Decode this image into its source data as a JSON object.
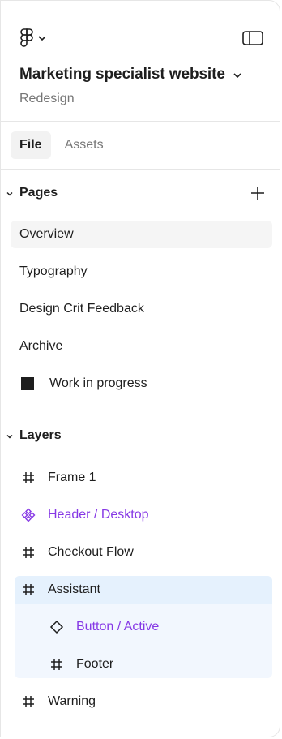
{
  "header": {
    "logo_icon": "figma-logo-icon",
    "menu_caret_icon": "chevron-down-icon",
    "sidebar_toggle_icon": "sidebar-panel-icon",
    "file_title": "Marketing specialist website",
    "file_subtitle": "Redesign"
  },
  "tabs": [
    {
      "label": "File",
      "active": true
    },
    {
      "label": "Assets",
      "active": false
    }
  ],
  "pages": {
    "title": "Pages",
    "add_icon": "plus-icon",
    "items": [
      {
        "label": "Overview",
        "selected": true
      },
      {
        "label": "Typography"
      },
      {
        "label": "Design Crit Feedback"
      },
      {
        "label": "Archive"
      },
      {
        "label": "Work in progress",
        "icon": "black-square-icon"
      }
    ]
  },
  "layers": {
    "title": "Layers",
    "items": [
      {
        "label": "Frame 1",
        "icon": "frame-icon"
      },
      {
        "label": "Header / Desktop",
        "icon": "component-icon",
        "color": "#8638e5"
      },
      {
        "label": "Checkout Flow",
        "icon": "frame-icon"
      },
      {
        "label": "Assistant",
        "icon": "frame-icon",
        "selected": true
      },
      {
        "label": "Button / Active",
        "icon": "instance-icon",
        "color": "#8638e5",
        "nested": true
      },
      {
        "label": "Footer",
        "icon": "frame-icon",
        "nested": true
      },
      {
        "label": "Warning",
        "icon": "frame-icon"
      }
    ]
  },
  "colors": {
    "component": "#8638e5",
    "selection": "#e5f1fd",
    "selection_child": "#f2f7fe",
    "text": "#1e1e1e",
    "muted": "#757575"
  }
}
